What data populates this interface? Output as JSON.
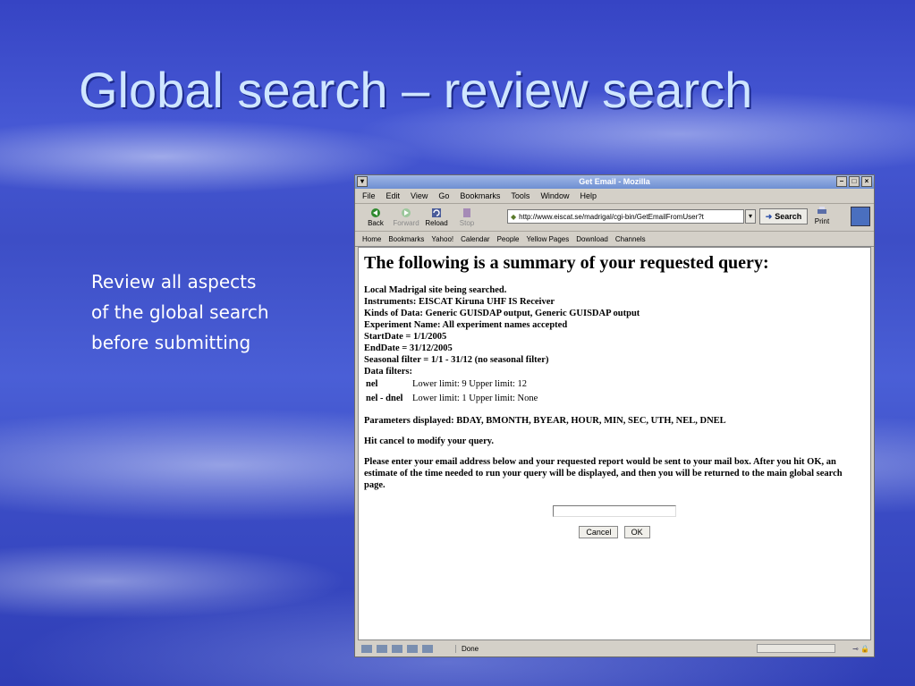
{
  "slide": {
    "title": "Global search – review search",
    "text_lines": [
      "Review all aspects",
      "of the global search",
      "before submitting"
    ]
  },
  "browser": {
    "window_title": "Get Email - Mozilla",
    "menu": [
      "File",
      "Edit",
      "View",
      "Go",
      "Bookmarks",
      "Tools",
      "Window",
      "Help"
    ],
    "toolbar": {
      "back": "Back",
      "forward": "Forward",
      "reload": "Reload",
      "stop": "Stop",
      "search": "Search",
      "print": "Print"
    },
    "url": "http://www.eiscat.se/madrigal/cgi-bin/GetEmailFromUser?t",
    "personal_toolbar": [
      "Home",
      "Bookmarks",
      "Yahoo!",
      "Calendar",
      "People",
      "Yellow Pages",
      "Download",
      "Channels"
    ],
    "status": "Done"
  },
  "page": {
    "heading": "The following is a summary of your requested query:",
    "lines": [
      "Local Madrigal site being searched.",
      "Instruments: EISCAT Kiruna UHF IS Receiver",
      "Kinds of Data: Generic GUISDAP output, Generic GUISDAP output",
      "Experiment Name: All experiment names accepted",
      "StartDate = 1/1/2005",
      "EndDate = 31/12/2005",
      "Seasonal filter = 1/1 - 31/12 (no seasonal filter)",
      "Data filters:"
    ],
    "filters": [
      {
        "name": "nel",
        "limits": "Lower limit: 9 Upper limit: 12"
      },
      {
        "name": "nel - dnel",
        "limits": "Lower limit: 1 Upper limit: None"
      }
    ],
    "parameters": "Parameters displayed: BDAY, BMONTH, BYEAR, HOUR, MIN, SEC, UTH, NEL, DNEL",
    "cancel_hint": "Hit cancel to modify your query.",
    "instructions": "Please enter your email address below and your requested report would be sent to your mail box. After you hit OK, an estimate of the time needed to run your query will be displayed, and then you will be returned to the main global search page.",
    "email_value": "",
    "cancel_label": "Cancel",
    "ok_label": "OK"
  }
}
